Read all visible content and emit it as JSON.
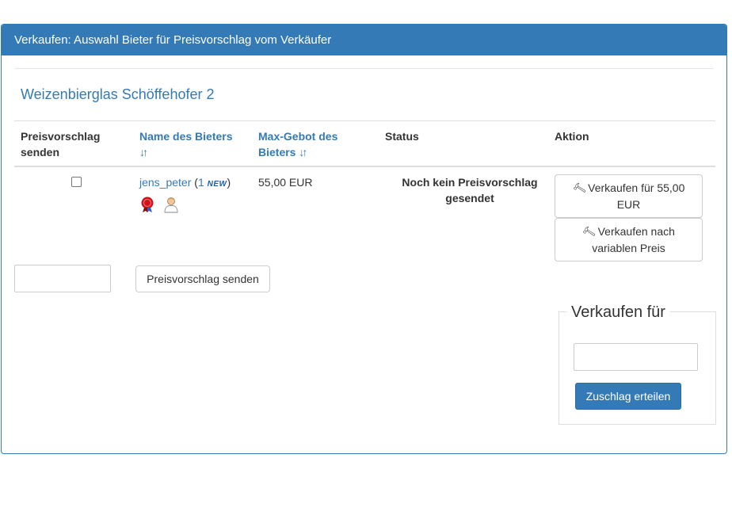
{
  "panel": {
    "title": "Verkaufen: Auswahl Bieter für Preisvorschlag vom Verkäufer"
  },
  "product": {
    "title": "Weizenbierglas Schöffehofer 2"
  },
  "table": {
    "headers": {
      "send_line1": "Preisvorschlag",
      "send_line2": "senden",
      "name": "Name des Bieters",
      "maxbid_line1": "Max-Gebot des",
      "maxbid_line2": "Bieters",
      "status": "Status",
      "action": "Aktion"
    },
    "rows": [
      {
        "bidder": "jens_peter",
        "rating_open": "(",
        "rating_count": "1",
        "rating_new": "NEW",
        "rating_close": ")",
        "max_bid": "55,00 EUR",
        "status_line1": "Noch kein Preisvorschlag",
        "status_line2": "gesendet",
        "sell_fixed_line1": "Verkaufen für 55,00",
        "sell_fixed_line2": "EUR",
        "sell_variable_line1": "Verkaufen nach",
        "sell_variable_line2": "variablen Preis"
      }
    ]
  },
  "offer": {
    "input_value": "",
    "send_label": "Preisvorschlag senden"
  },
  "sell_for": {
    "legend": "Verkaufen für",
    "input_value": "",
    "submit_label": "Zuschlag erteilen"
  },
  "colors": {
    "primary": "#337ab7",
    "border": "#dddddd"
  },
  "icons": {
    "sort": "sort-arrows-icon",
    "gavel": "gavel-icon",
    "seal": "red-seal-badge-icon",
    "user": "user-avatar-icon"
  }
}
